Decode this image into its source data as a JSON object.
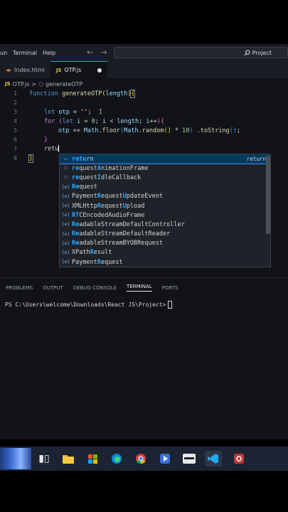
{
  "menu": {
    "partial": "un",
    "terminal": "Terminal",
    "help": "Help"
  },
  "nav": {
    "back": "←",
    "forward": "→"
  },
  "search": {
    "label": "Project"
  },
  "tabs": [
    {
      "label": "Index.html",
      "icon": "html-icon"
    },
    {
      "label": "OTP.js",
      "icon": "js-icon",
      "modified": true
    }
  ],
  "breadcrumb": {
    "file": "OTP.js",
    "sep": ">",
    "symbol": "generateOTP"
  },
  "editor": {
    "line_numbers": [
      "1",
      "2",
      "3",
      "4",
      "5",
      "6",
      "7",
      "8"
    ],
    "typed": "retu"
  },
  "suggestions": [
    {
      "match": "retu",
      "rest": "rn",
      "kind": "keyword",
      "detail": "return"
    },
    {
      "match": "re",
      "mid": "quest",
      "match2": "A",
      "rest": "nimationFrame",
      "kind": "function"
    },
    {
      "match": "re",
      "mid": "quest",
      "match2": "I",
      "rest": "dleCallback",
      "kind": "function"
    },
    {
      "match": "Re",
      "mid": "quest",
      "kind": "variable"
    },
    {
      "pre": "Payment",
      "match": "R",
      "mid": "equest",
      "match2": "U",
      "rest": "pdateEvent",
      "kind": "variable"
    },
    {
      "pre": "XMLHttp",
      "match": "R",
      "mid": "equest",
      "match2": "U",
      "rest": "pload",
      "kind": "variable"
    },
    {
      "pre": "",
      "match": "RT",
      "mid": "CEncodedAudioFrame",
      "kind": "variable"
    },
    {
      "pre": "",
      "match": "Re",
      "mid": "adableStreamDefaultController",
      "kind": "variable"
    },
    {
      "pre": "",
      "match": "Re",
      "mid": "adableStreamDefaultReader",
      "kind": "variable"
    },
    {
      "pre": "",
      "match": "Re",
      "mid": "adableStreamBYOBRequest",
      "kind": "variable"
    },
    {
      "pre": "XPath",
      "match": "R",
      "mid": "esult",
      "kind": "variable"
    },
    {
      "pre": "Payment",
      "match": "R",
      "mid": "equest",
      "kind": "variable"
    }
  ],
  "panel": {
    "tabs": [
      "PROBLEMS",
      "OUTPUT",
      "DEBUG CONSOLE",
      "TERMINAL",
      "PORTS"
    ],
    "active": "TERMINAL"
  },
  "terminal": {
    "prompt": "PS C:\\Users\\welcome\\Downloads\\React JS\\Project>"
  },
  "taskbar": {
    "icons": [
      "weather-icon",
      "task-view-icon",
      "file-explorer-icon",
      "store-icon",
      "edge-icon",
      "chrome-icon",
      "media-player-icon",
      "terminal-icon",
      "vscode-icon",
      "snipping-tool-icon"
    ]
  }
}
